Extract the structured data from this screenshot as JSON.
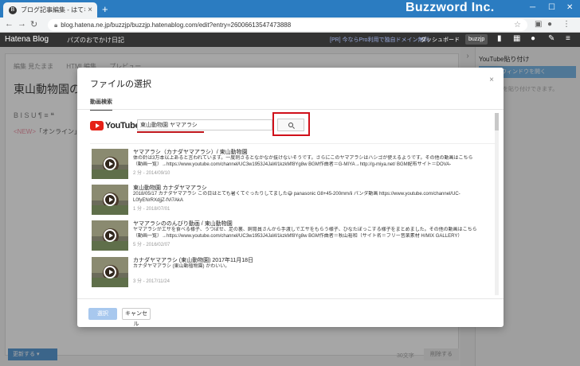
{
  "browser": {
    "tab_title": "ブログ記事編集 - はてなブログ",
    "new_tab": "+",
    "brand_overlay": "Buzzword Inc.",
    "url": "blog.hatena.ne.jp/buzzjp/buzzjp.hatenablog.com/edit?entry=26006613547473888",
    "min": "─",
    "max": "☐",
    "close": "✕"
  },
  "hatena_header": {
    "logo": "Hatena Blog",
    "blog_name": "パズのおでかけ日記",
    "pro_banner": "[PR] 今ならPro利用で独自ドメイン無料",
    "dashboard": "ダッシュボード",
    "user": "buzzjp"
  },
  "editor": {
    "tabs": [
      "編集 見たまま",
      "HTML編集",
      "プレビュー"
    ],
    "title": "東山動物園のヤマアラシ",
    "toolbar": "B  I  S  U  ¶  ≡  ❝",
    "body_new": "<NEW>",
    "body_text": "「オンライン」どう"
  },
  "sidebar": {
    "title": "YouTube貼り付け",
    "button": "選択ウィンドウを開く",
    "description": "動画を貼り付けできます。"
  },
  "footer": {
    "update": "更新する",
    "char_count": "30文字",
    "delete": "削除する"
  },
  "modal": {
    "title": "ファイルの選択",
    "close": "×",
    "tab": "動画検索",
    "youtube_logo": "YouTube",
    "search_value": "東山動物園 ヤマアラシ",
    "results": [
      {
        "title": "ヤマアラシ（カナダヤマアラシ）/ 東山動物園",
        "desc1": "体の針は3万本以上あると言われています。一度刺さるとなかなか抜けないそうです。さらにこのヤマアラシはハシゴが使えるようです。その他の動画はこちら",
        "desc2": "（動画一覧）→https://www.youtube.com/channel/UC3w1953J4JaW1kzkMf8Yg8w BGM作曲者＝G-MIYA→http://g-miya.net/ BGM配布サイト＝DOVA-",
        "meta": "2 分 - 2014/09/10"
      },
      {
        "title": "東山動物園 カナダヤマアラシ",
        "desc1": "2018/05/17 カナダヤマアラシ この日はとても暑くてぐったりしてました😅 panasonic G8+45-200mm/ii パンダ動画 https://www.youtube.com/channel/UC-",
        "desc2": "L0fyENrRXdjjZ-fVi7AkA",
        "meta": "1 分 - 2018/07/01"
      },
      {
        "title": "ヤマアラシののんびり動画 / 東山動物園",
        "desc1": "ヤマアラシがエサを食べる様子、うつぼせ、足の裏、飼育員さんから手渡しでエサをもらう様子、ひなたぼっこする様子をまとめました。その他の動画はこちら",
        "desc2": "（動画一覧）→https://www.youtube.com/channel/UC3w1953J4JaW1kzkMf8Yg8w BGM作曲者＝秋山裕和（サイト名＝フリー音楽素材 H/MIX GALLERY）",
        "meta": "5 分 - 2016/02/07"
      },
      {
        "title": "カナダヤマアラシ (東山動物園) 2017年11月18日",
        "desc1": "カナダヤマアラシ (東山動植物園) かわいい。",
        "desc2": "",
        "meta": "3 分 - 2017/11/24"
      }
    ],
    "select_button": "選択",
    "cancel_button": "キャンセル"
  }
}
